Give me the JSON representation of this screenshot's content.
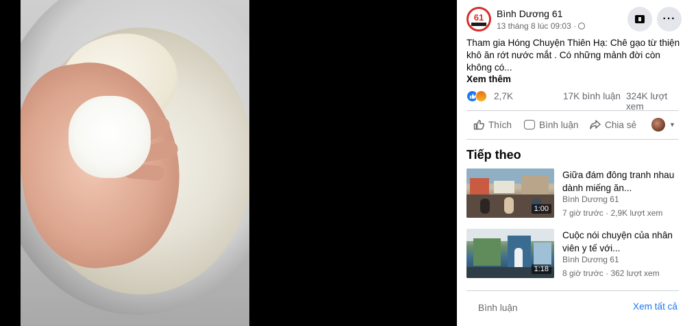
{
  "post": {
    "page_name": "Bình Dương 61",
    "avatar_text": "61",
    "timestamp": "13 tháng 8 lúc 09:03 ·",
    "text_prefix": "Tham gia ",
    "tagged_page": "Hóng Chuyện Thiên Hạ",
    "text_body": ": Chê gạo từ thiện khô ăn rớt nước mắt . Có những mảnh đời còn không có...",
    "see_more": "Xem thêm",
    "reaction_count": "2,7K",
    "comment_count": "17K bình luận",
    "view_count": "324K lượt xem"
  },
  "actions": {
    "like": "Thích",
    "comment": "Bình luận",
    "share": "Chia sẻ"
  },
  "up_next": {
    "heading": "Tiếp theo",
    "items": [
      {
        "title": "Giữa đám đông tranh nhau dành miếng ăn...",
        "channel": "Bình Dương 61",
        "meta": "7 giờ trước · 2,9K lượt xem",
        "duration": "1:00"
      },
      {
        "title": "Cuộc nói chuyện của nhân viên y tế với...",
        "channel": "Bình Dương 61",
        "meta": "8 giờ trước · 362 lượt xem",
        "duration": "1:18"
      }
    ]
  },
  "footer": {
    "label": "Bình luận",
    "see_all": "Xem tất cả"
  },
  "icons": [
    "globe-icon",
    "save-icon",
    "more-icon",
    "like-reaction-icon",
    "angry-reaction-icon",
    "like-icon",
    "comment-icon",
    "share-icon",
    "caret-down-icon"
  ],
  "colors": {
    "brand_blue": "#1877f2",
    "secondary_text": "#65676b",
    "avatar_red": "#d62b2b"
  }
}
